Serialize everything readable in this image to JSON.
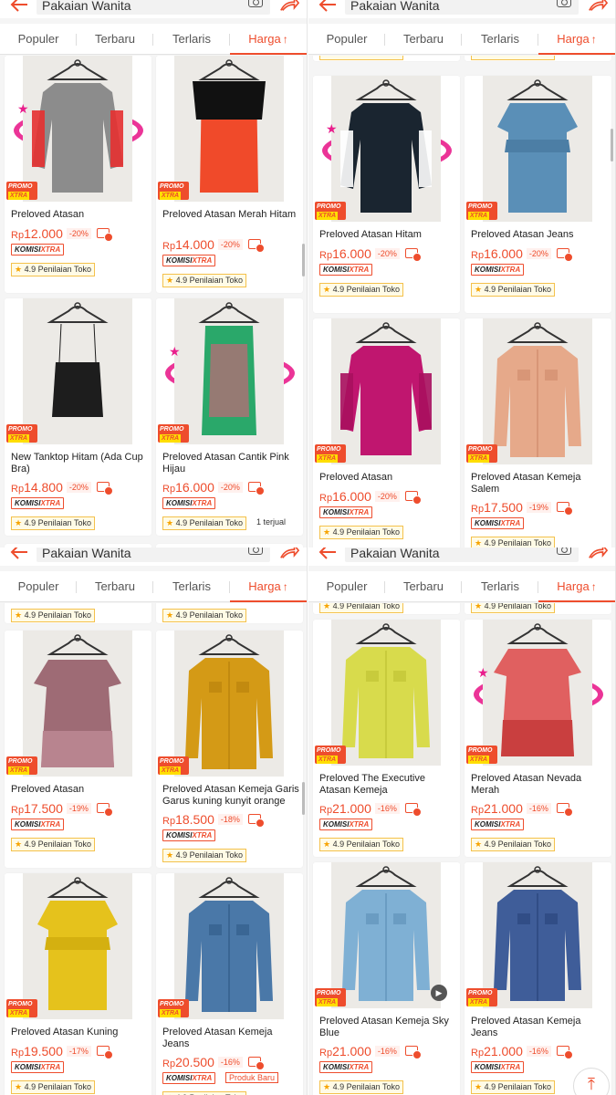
{
  "header": {
    "search_text": "Pakaian Wanita"
  },
  "tabs": {
    "populer": "Populer",
    "terbaru": "Terbaru",
    "terlaris": "Terlaris",
    "harga": "Harga",
    "harga_arrow": "↑"
  },
  "labels": {
    "komisi_prefix": "KOMISI",
    "komisi_suffix": "XTRA",
    "promo_line1": "PROMO",
    "promo_line2": "XTRA",
    "rp": "Rp",
    "rating": "4.9 Penilaian Toko",
    "sold": "1 terjual",
    "new_product": "Produk Baru"
  },
  "colors": {
    "accent": "#ee4d2d",
    "promo_yellow": "#ffde00",
    "swirl": "#e91e8c"
  },
  "screens": [
    {
      "products": [
        {
          "name": "Preloved Atasan",
          "price": "12.000",
          "discount": "-20%"
        },
        {
          "name": "Preloved Atasan Merah Hitam",
          "price": "14.000",
          "discount": "-20%"
        },
        {
          "name": "New Tanktop Hitam (Ada Cup Bra)",
          "price": "14.800",
          "discount": "-20%"
        },
        {
          "name": "Preloved Atasan Cantik Pink Hijau",
          "price": "16.000",
          "discount": "-20%"
        }
      ]
    },
    {
      "products": [
        {
          "name": "Preloved Atasan Hitam",
          "price": "16.000",
          "discount": "-20%"
        },
        {
          "name": "Preloved Atasan Jeans",
          "price": "16.000",
          "discount": "-20%"
        },
        {
          "name": "Preloved Atasan",
          "price": "16.000",
          "discount": "-20%"
        },
        {
          "name": "Preloved Atasan Kemeja Salem",
          "price": "17.500",
          "discount": "-19%"
        }
      ]
    },
    {
      "products": [
        {
          "name": "Preloved Atasan",
          "price": "17.500",
          "discount": "-19%"
        },
        {
          "name": "Preloved Atasan Kemeja Garis Garus kuning kunyit orange",
          "price": "18.500",
          "discount": "-18%"
        },
        {
          "name": "Preloved Atasan Kuning",
          "price": "19.500",
          "discount": "-17%"
        },
        {
          "name": "Preloved Atasan Kemeja Jeans",
          "price": "20.500",
          "discount": "-16%"
        }
      ]
    },
    {
      "products": [
        {
          "name": "Preloved The Executive Atasan Kemeja",
          "price": "21.000",
          "discount": "-16%"
        },
        {
          "name": "Preloved Atasan Nevada Merah",
          "price": "21.000",
          "discount": "-16%"
        },
        {
          "name": "Preloved Atasan Kemeja Sky Blue",
          "price": "21.000",
          "discount": "-16%"
        },
        {
          "name": "Preloved Atasan Kemeja Jeans",
          "price": "21.000",
          "discount": "-16%"
        }
      ]
    }
  ]
}
